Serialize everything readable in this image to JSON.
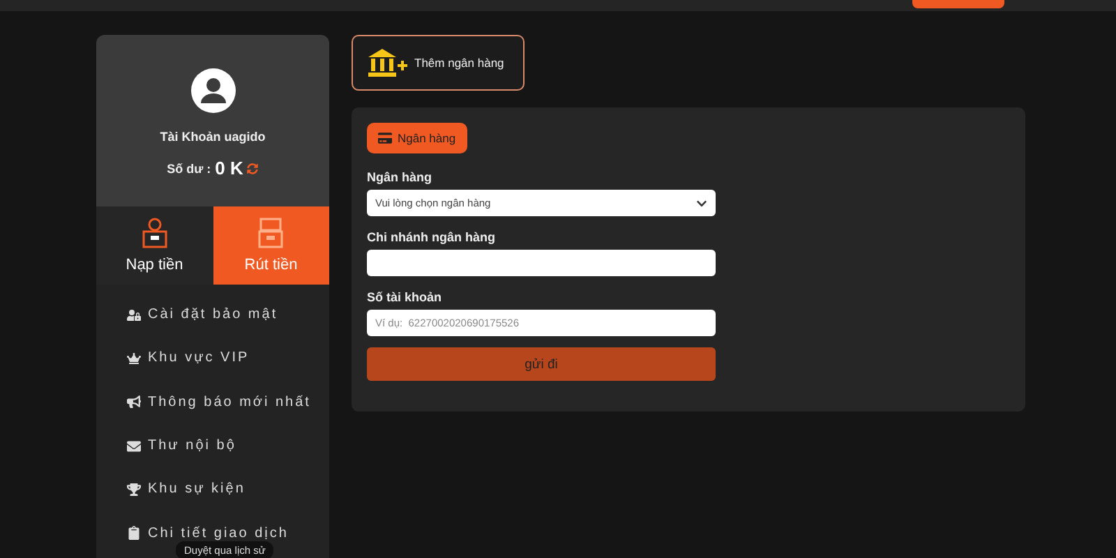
{
  "profile": {
    "account": "Tài Khoản uagido",
    "balance_label": "Số dư :",
    "balance": "0 K"
  },
  "tabs": [
    {
      "label": "Nạp tiền",
      "selected": false
    },
    {
      "label": "Rút tiền",
      "selected": true
    }
  ],
  "menu": [
    {
      "label": "Cài đặt bảo mật"
    },
    {
      "label": "Khu vực VIP"
    },
    {
      "label": "Thông báo mới nhất"
    },
    {
      "label": "Thư nội bộ"
    },
    {
      "label": "Khu sự kiện"
    },
    {
      "label": "Chi tiết giao dịch"
    }
  ],
  "tooltip": "Duyệt qua lịch sử",
  "add_bank_button": "Thêm ngân hàng",
  "panel": {
    "tab": "Ngân hàng",
    "fields": [
      {
        "label": "Ngân hàng",
        "kind": "select",
        "value": "Vui lòng chọn ngân hàng"
      },
      {
        "label": "Chi nhánh ngân hàng",
        "kind": "text"
      },
      {
        "label": "Số tài khoản",
        "kind": "text",
        "placeholder": "Ví dụ:  6227002020690175526"
      }
    ],
    "submit": "gửi đi"
  }
}
